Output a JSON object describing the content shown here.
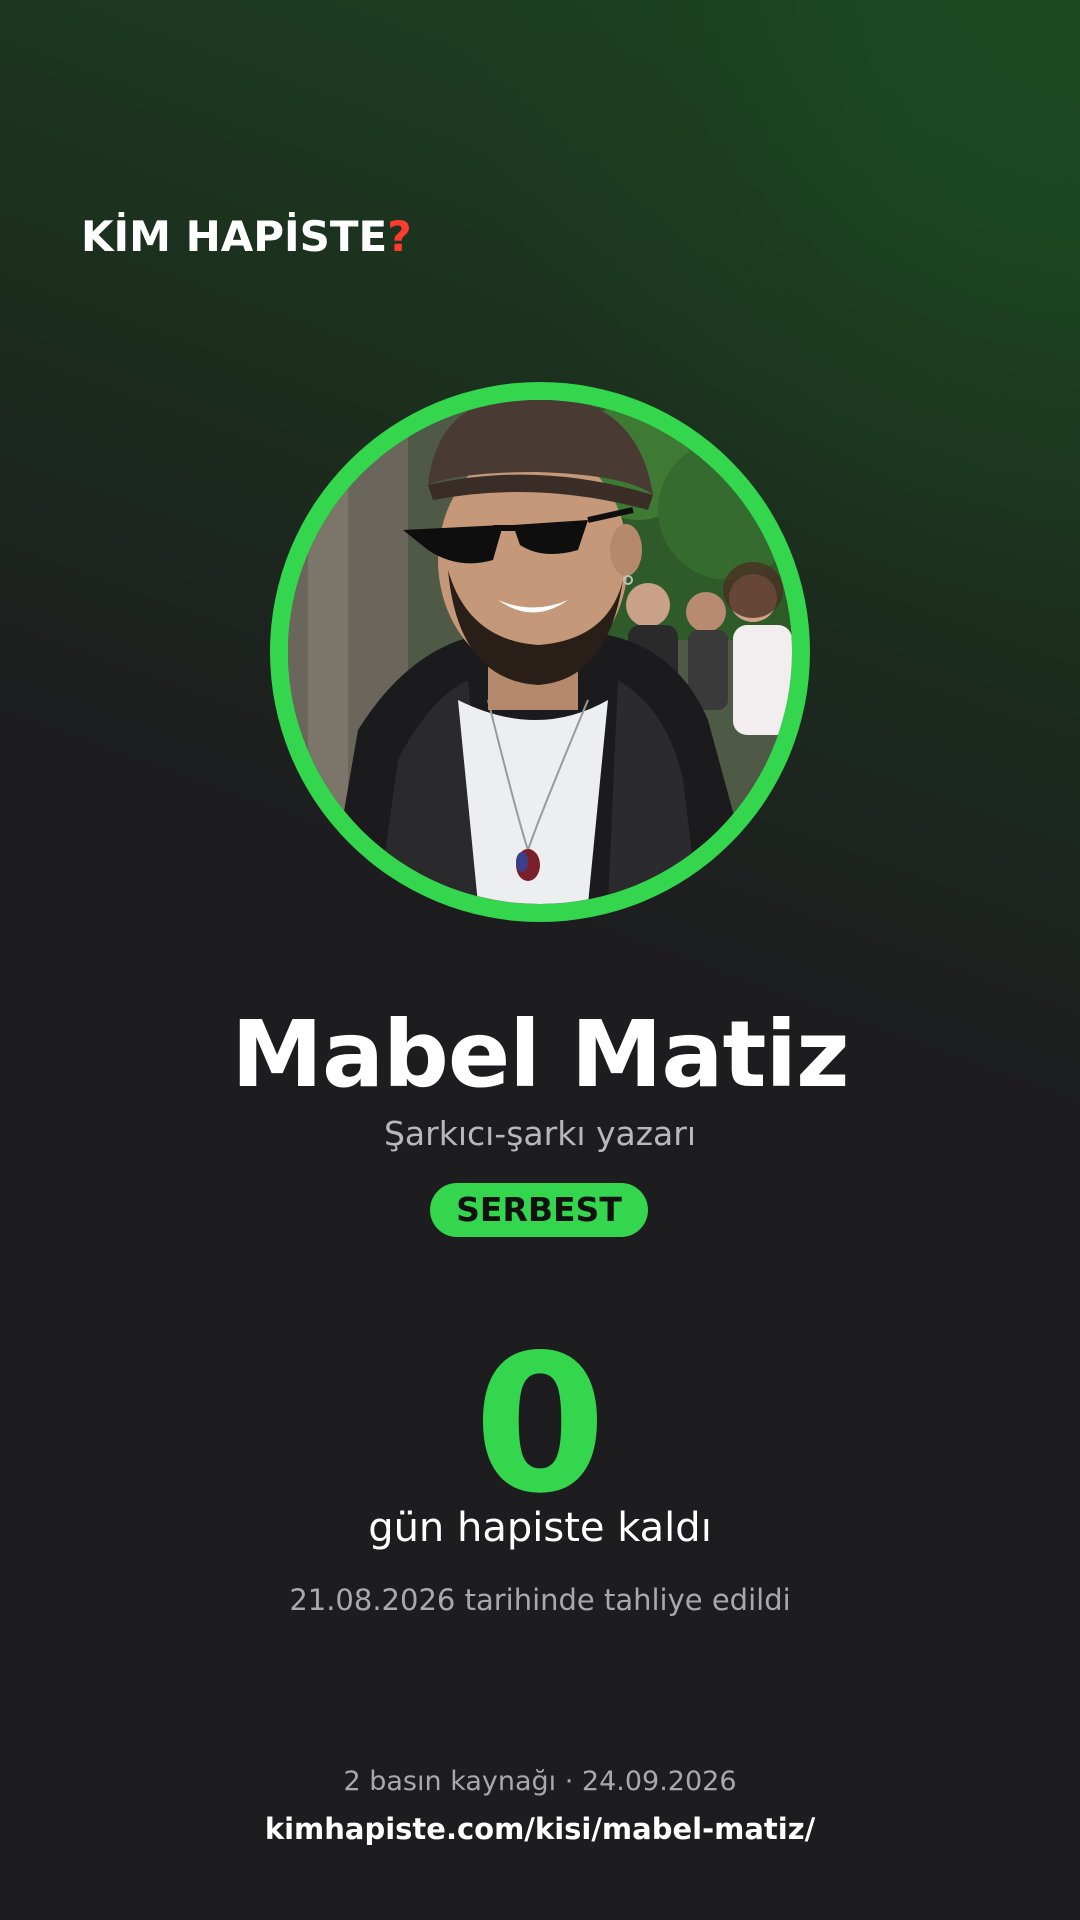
{
  "brand": {
    "logo_text": "KİM HAPİSTE",
    "logo_mark": "?",
    "accent_color": "#33d64d",
    "mark_color": "#ff3b30",
    "background_color": "#1d1d1f"
  },
  "profile": {
    "avatar_icon": "person-photo",
    "name": "Mabel Matiz",
    "role": "Şarkıcı-şarkı yazarı",
    "status_badge": "SERBEST"
  },
  "stats": {
    "days_value": "0",
    "days_label": "gün hapiste kaldı",
    "release_text": "21.08.2026 tarihinde tahliye edildi"
  },
  "footer": {
    "sources_text": "2 basın kaynağı · 24.09.2026",
    "url": "kimhapiste.com/kisi/mabel-matiz/"
  }
}
